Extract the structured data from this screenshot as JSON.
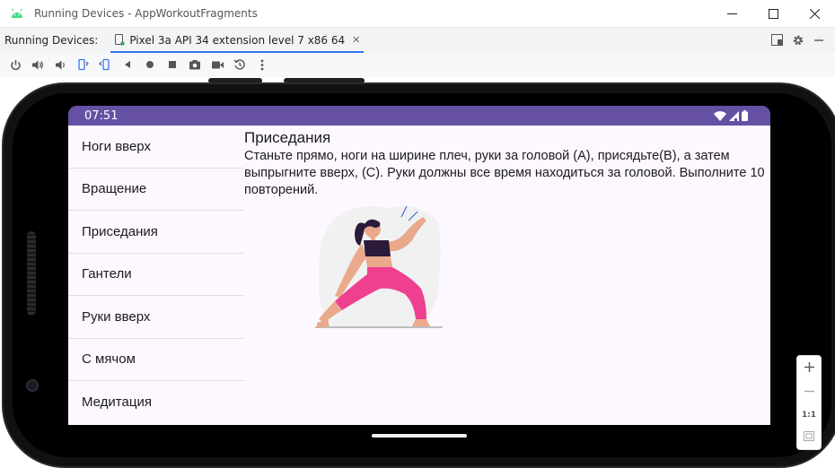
{
  "window": {
    "title": "Running Devices - AppWorkoutFragments",
    "minimize_icon": "minimize-icon",
    "maximize_icon": "maximize-icon",
    "close_icon": "close-icon"
  },
  "tabbar": {
    "label": "Running Devices:",
    "device_tab": "Pixel 3a API 34 extension level 7 x86 64"
  },
  "toolbar": {
    "icons": [
      "power-icon",
      "volume-up-icon",
      "volume-down-icon",
      "rotate-left-icon",
      "rotate-right-icon",
      "back-icon",
      "home-icon",
      "overview-icon",
      "screenshot-icon",
      "screen-record-icon",
      "snapshot-icon",
      "more-icon"
    ]
  },
  "phone": {
    "status_time": "07:51"
  },
  "exercises": [
    "Ноги вверх",
    "Вращение",
    "Приседания",
    "Гантели",
    "Руки вверх",
    "С мячом",
    "Медитация"
  ],
  "detail": {
    "title": "Приседания",
    "description": "Станьте прямо, ноги на ширине плеч, руки за головой (А), присядьте(В), а затем выпрыгните вверх, (С). Руки должны все время находиться за головой. Выполните 10 повторений."
  },
  "zoom": {
    "reset_label": "1:1"
  },
  "colors": {
    "status_bar": "#6650a4",
    "screen_bg": "#fdf7ff",
    "tab_accent": "#3574f0",
    "pants": "#ef3f8f"
  }
}
